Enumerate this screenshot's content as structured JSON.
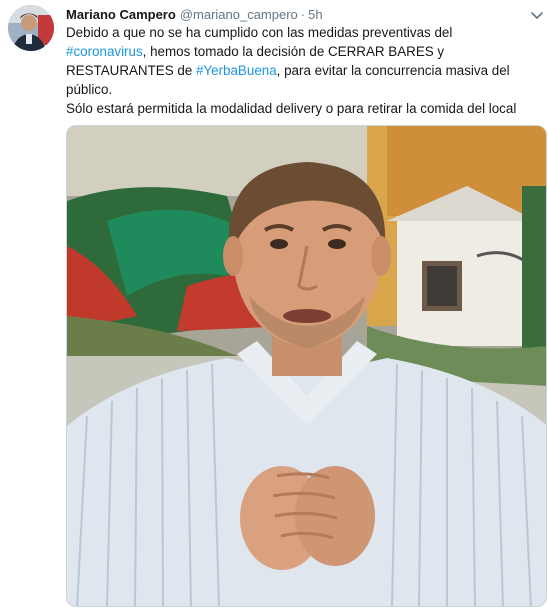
{
  "tweet": {
    "author_name": "Mariano Campero",
    "handle": "@mariano_campero",
    "separator": "·",
    "time": "5h",
    "text_1": "Debido a que no se ha cumplido con las medidas preventivas del",
    "hashtag_1": "#coronavirus",
    "text_2": ", hemos tomado la decisión de CERRAR BARES y RESTAURANTES de",
    "hashtag_2": "#YerbaBuena",
    "text_3": ", para evitar la concurrencia masiva del público.",
    "text_4": "Sólo estará permitida la modalidad delivery o para retirar la comida del local",
    "menu_icon": "chevron-down-icon"
  },
  "colors": {
    "link": "#1b95e0",
    "text": "#14171a",
    "muted": "#657786"
  }
}
